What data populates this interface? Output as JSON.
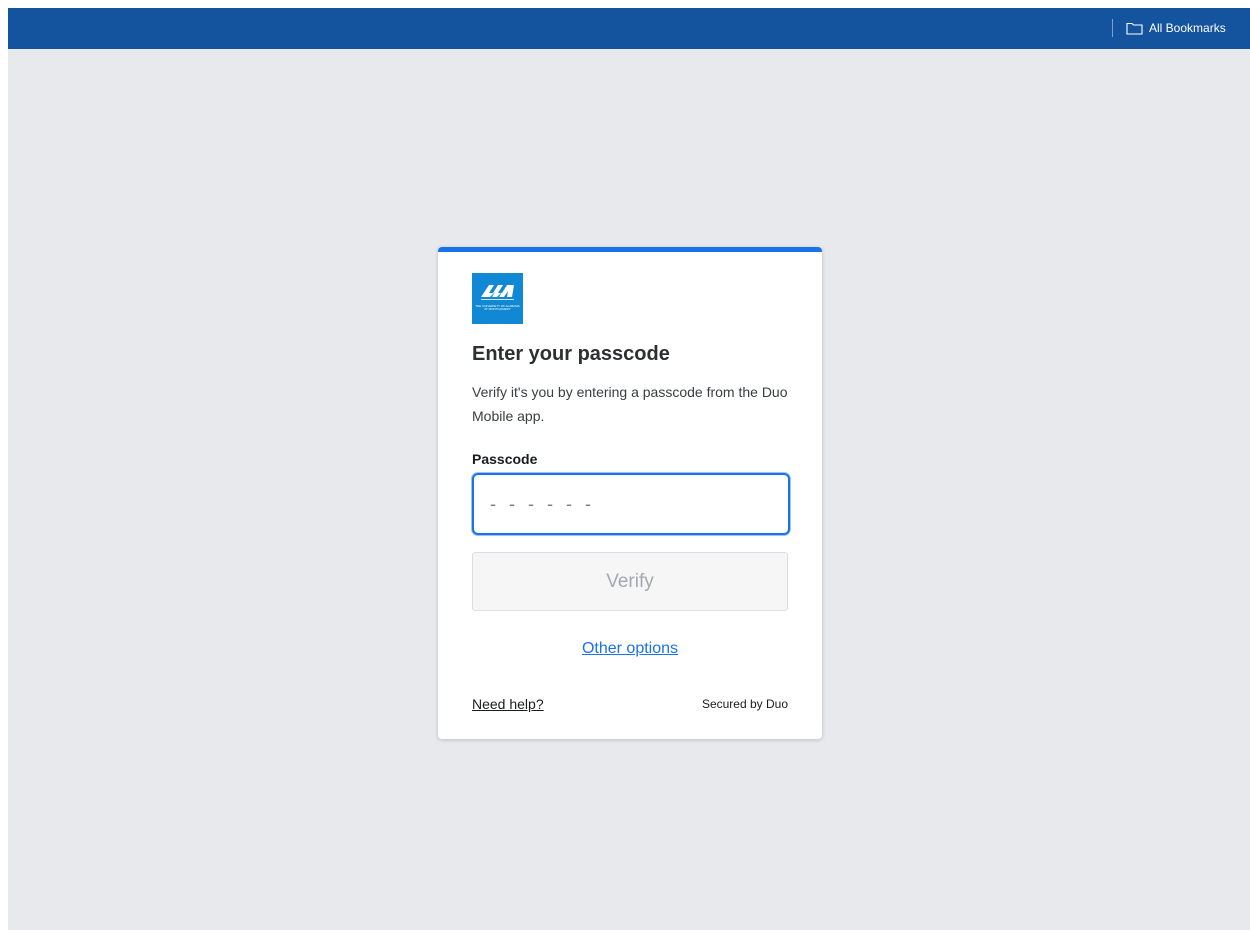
{
  "bookmarks_bar": {
    "all_bookmarks_label": "All Bookmarks",
    "folder_icon": "folder-icon",
    "bar_color": "#14539e"
  },
  "page": {
    "background_color": "#e8e9ed"
  },
  "card": {
    "accent_color": "#1a73e8",
    "logo": {
      "icon": "university-logo",
      "text": "THE UNIVERSITY OF ALABAMA AT MONTGOMERY",
      "color": "#1188d3"
    },
    "title": "Enter your passcode",
    "description": "Verify it's you by entering a passcode from the Duo Mobile app.",
    "passcode": {
      "label": "Passcode",
      "value": "",
      "placeholder": "- - - - - -"
    },
    "verify_label": "Verify",
    "other_options_label": "Other options",
    "need_help_label": "Need help?",
    "secured_by_label": "Secured by Duo"
  }
}
